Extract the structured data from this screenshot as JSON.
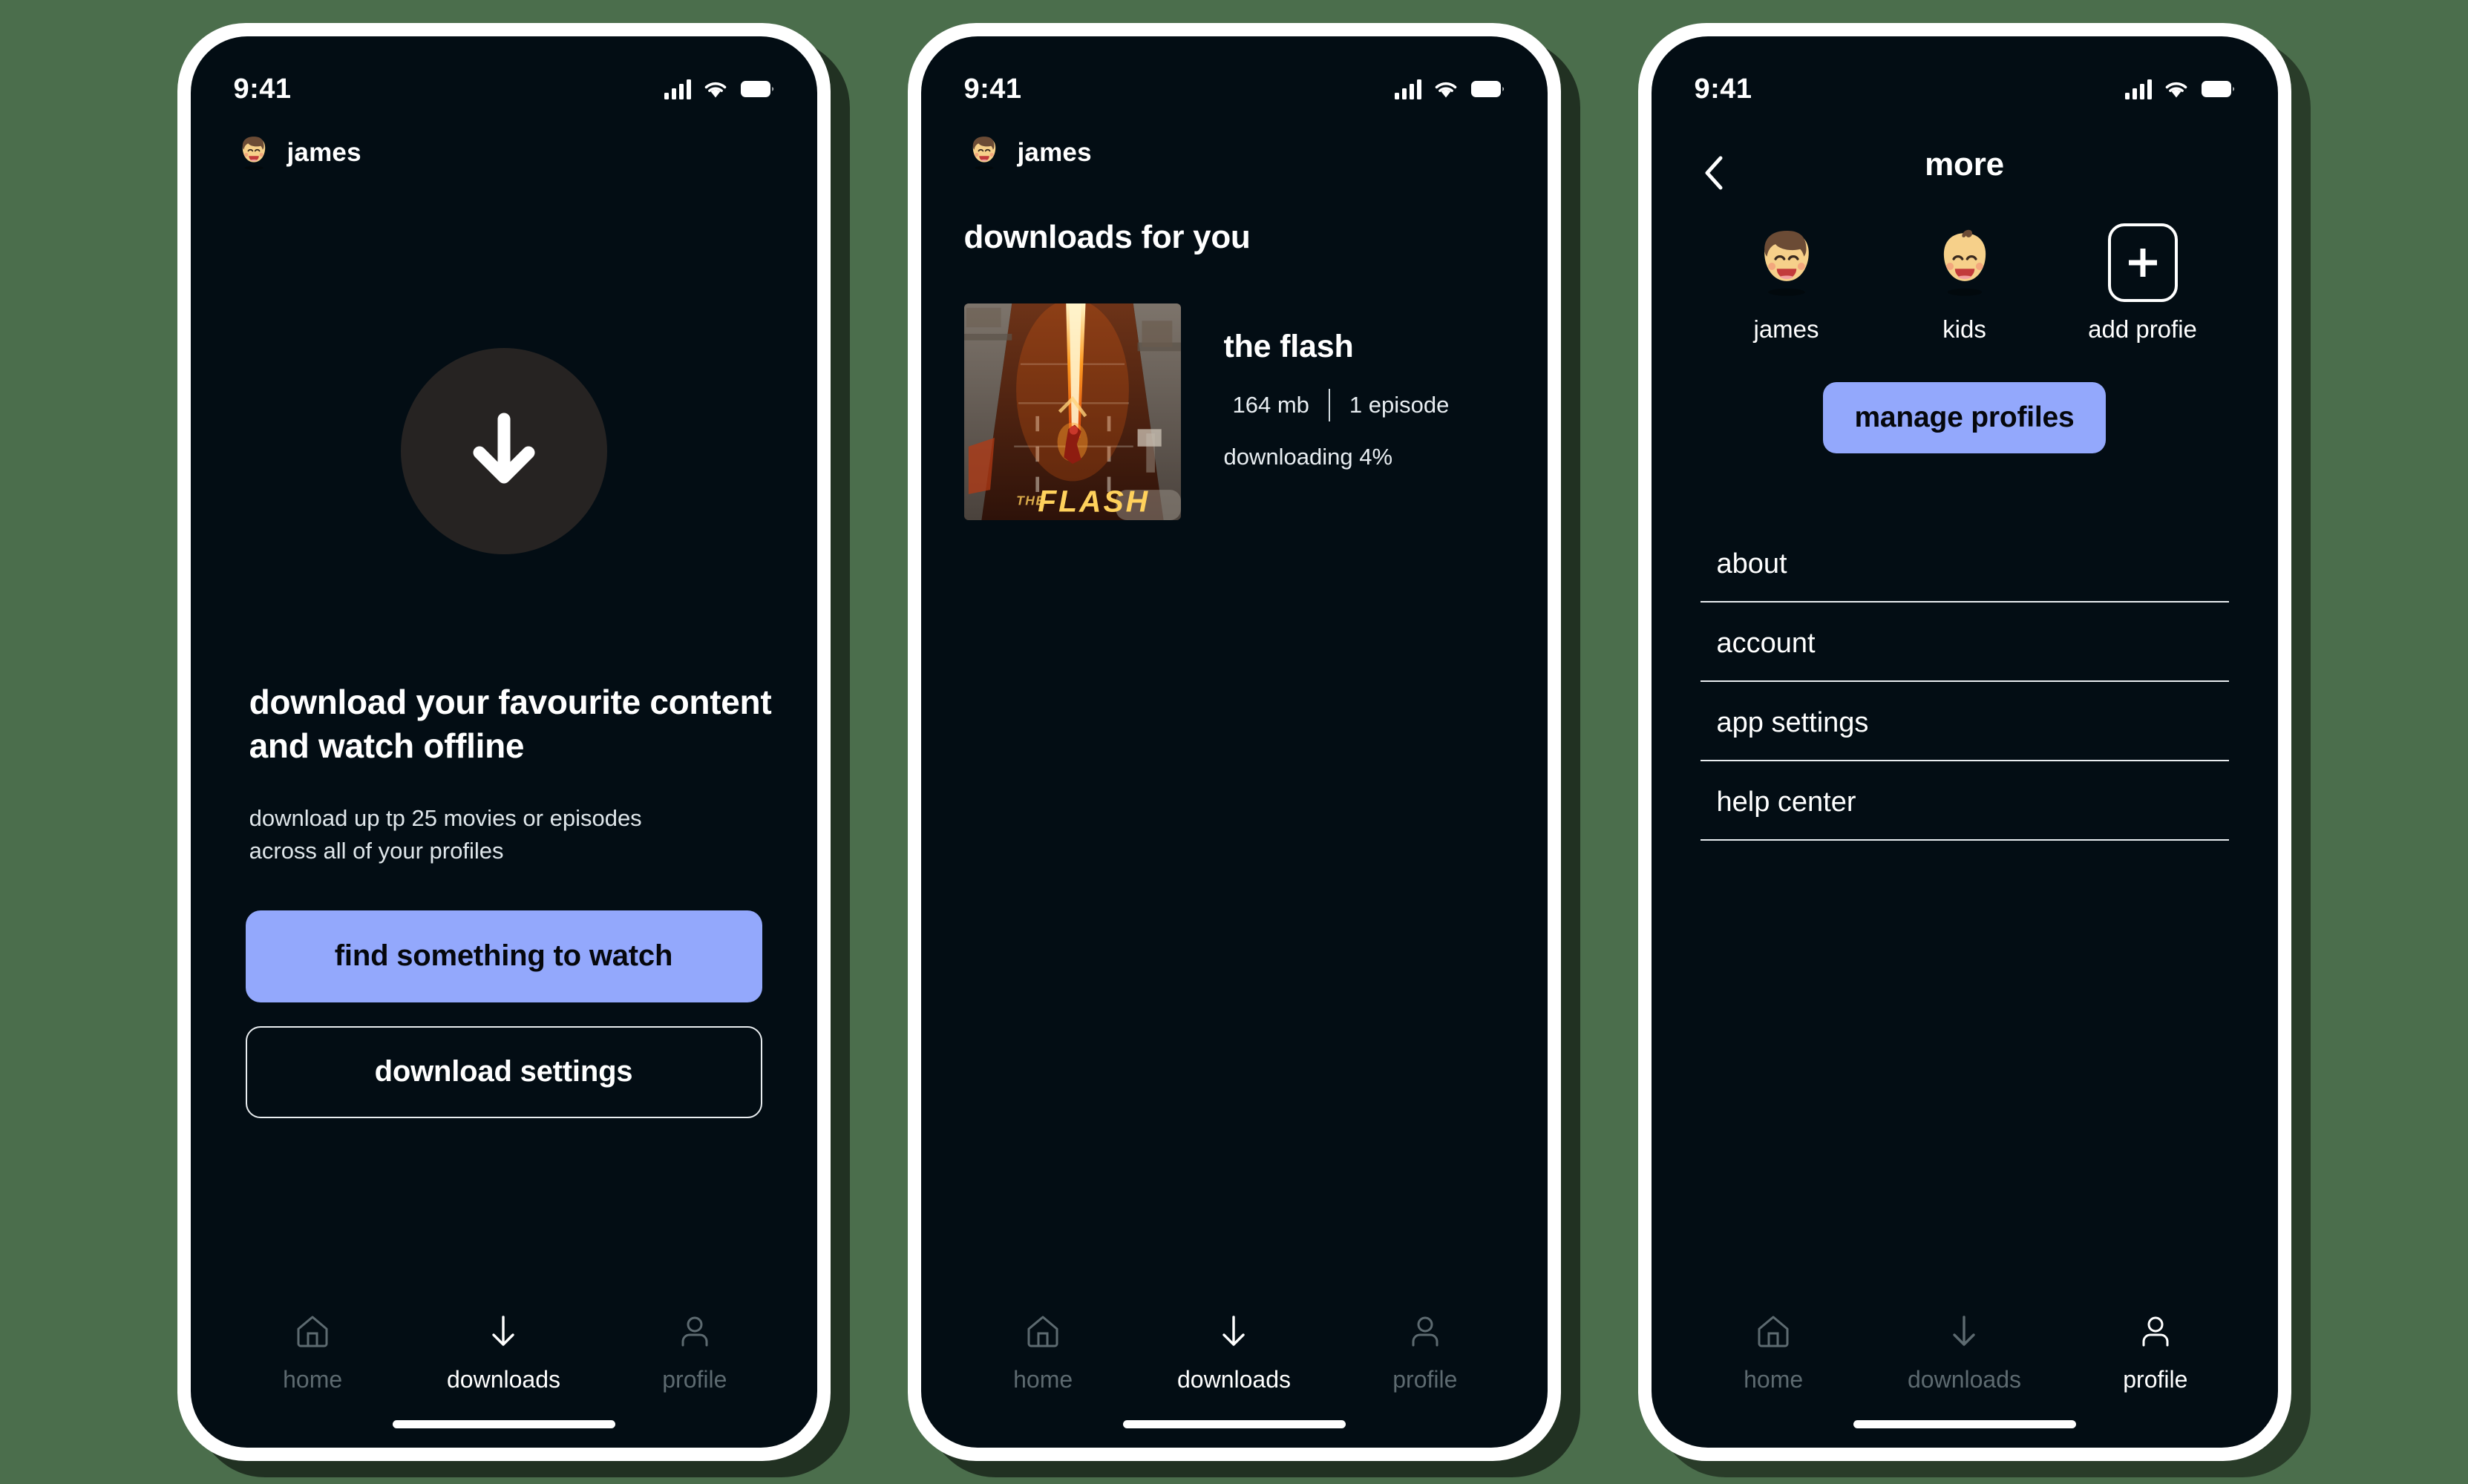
{
  "theme": {
    "page_bg": "#4b6e4c",
    "screen_bg": "#030d14",
    "accent": "#93a8fc",
    "text": "#ffffff",
    "muted": "#5d6a70"
  },
  "status_bar": {
    "time": "9:41",
    "signal_icon": "cellular-signal-icon",
    "wifi_icon": "wifi-icon",
    "battery_icon": "battery-icon"
  },
  "tabs": {
    "home": "home",
    "downloads": "downloads",
    "profile": "profile",
    "home_icon": "home-icon",
    "downloads_icon": "download-arrow-icon",
    "profile_icon": "person-icon"
  },
  "screen1": {
    "profile_name": "james",
    "profile_avatar_icon": "avatar-james-icon",
    "hero_icon": "download-arrow-circle-icon",
    "title_line1": "download your favourite content",
    "title_line2": "and watch offline",
    "sub_line1": "download up tp 25 movies or episodes",
    "sub_line2": "across all of your profiles",
    "primary_button": "find something to watch",
    "secondary_button": "download settings",
    "active_tab": "downloads"
  },
  "screen2": {
    "profile_name": "james",
    "profile_avatar_icon": "avatar-james-icon",
    "section_title": "downloads for you",
    "item": {
      "thumbnail_icon": "the-flash-poster-thumbnail",
      "thumbnail_logo_text": "FLASH",
      "thumbnail_logo_pretext": "THE",
      "title": "the flash",
      "size": "164 mb",
      "episodes": "1 episode",
      "status": "downloading 4%"
    },
    "active_tab": "downloads"
  },
  "screen3": {
    "back_icon": "chevron-left-icon",
    "title": "more",
    "profiles": [
      {
        "label": "james",
        "icon": "avatar-james-icon"
      },
      {
        "label": "kids",
        "icon": "avatar-kids-icon"
      },
      {
        "label": "add profie",
        "icon": "plus-box-icon"
      }
    ],
    "manage_button": "manage profiles",
    "menu": [
      "about",
      "account",
      "app settings",
      "help center"
    ],
    "active_tab": "profile"
  }
}
